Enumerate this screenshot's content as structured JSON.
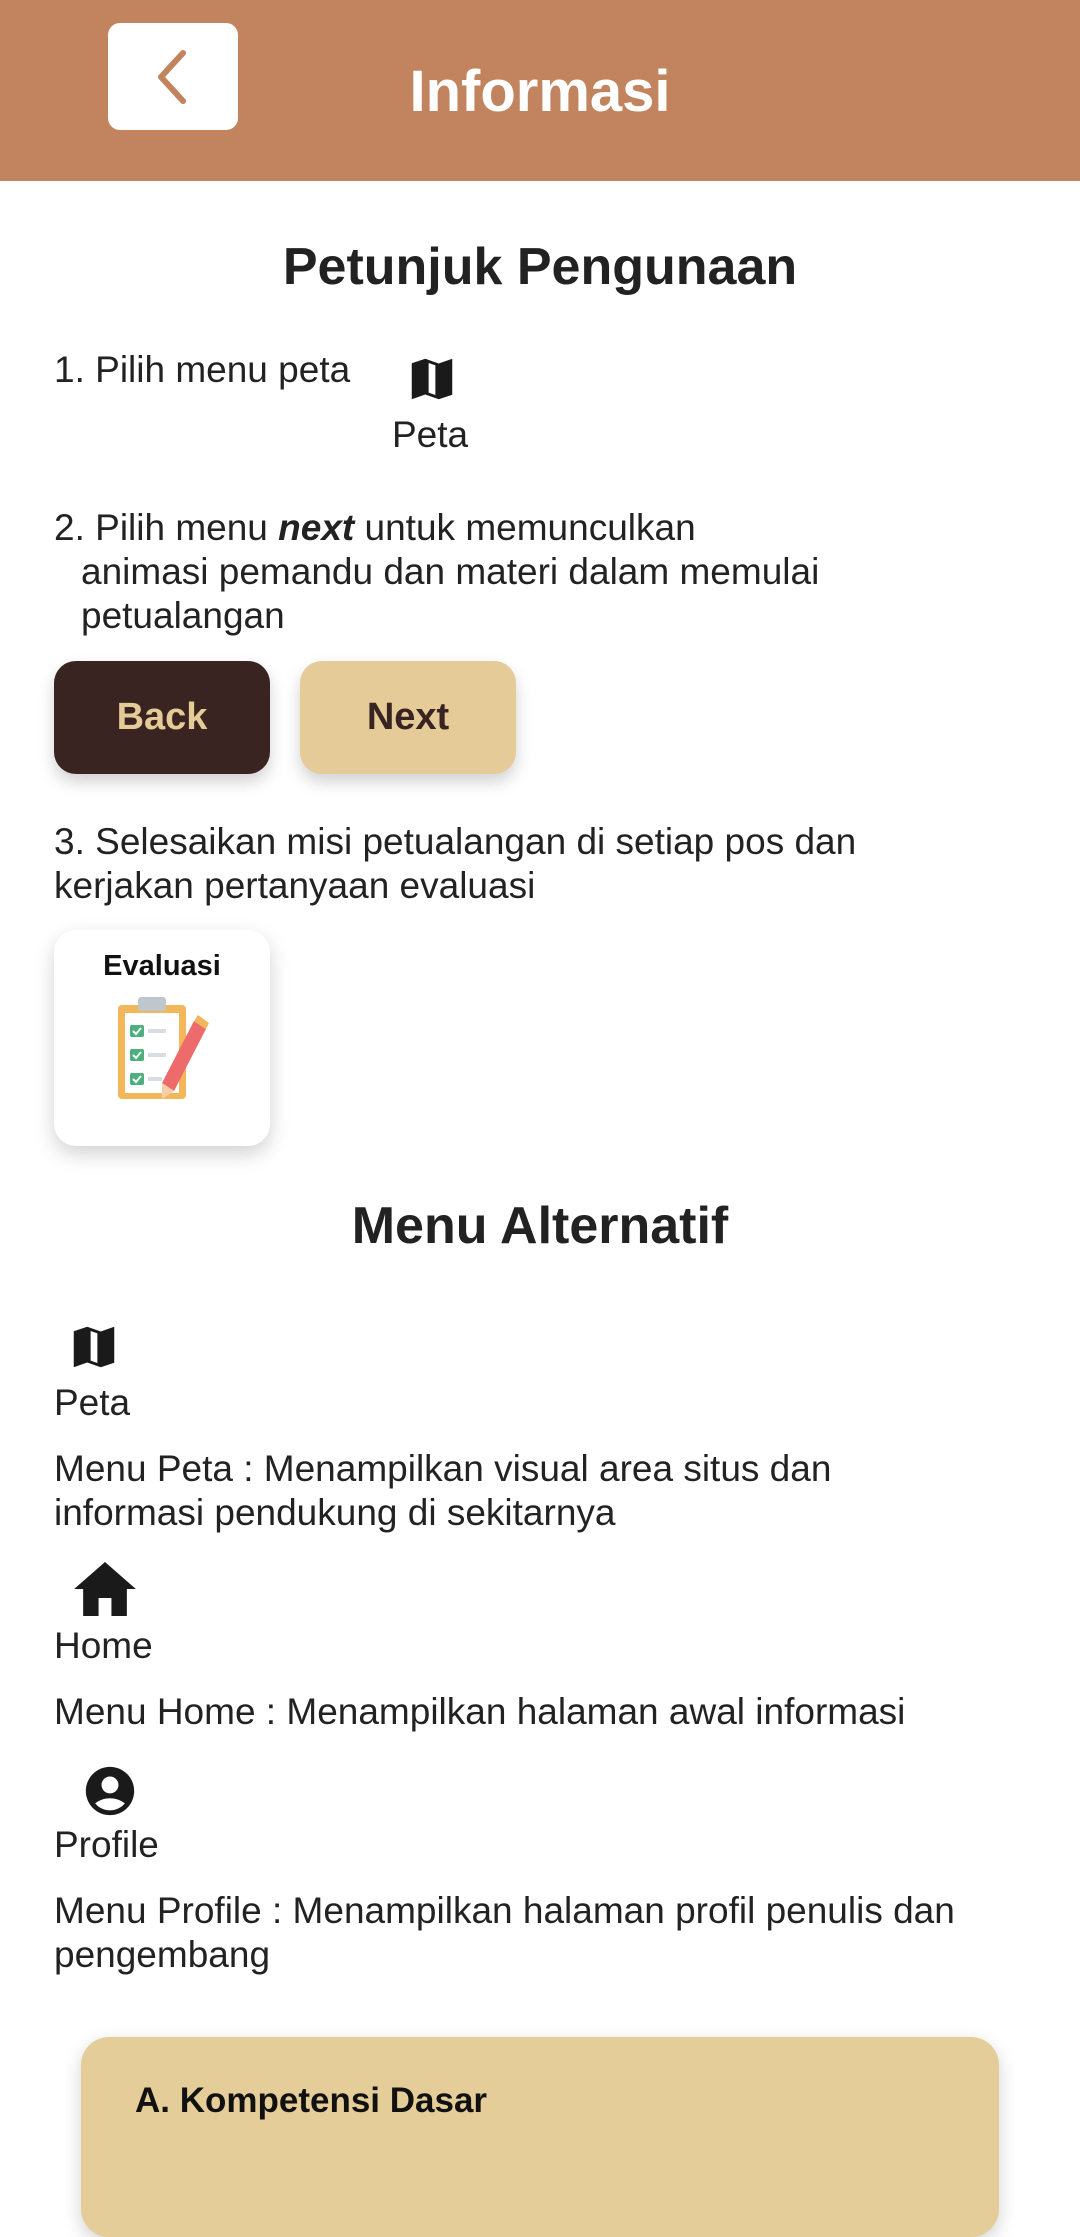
{
  "header": {
    "title": "Informasi",
    "back_icon": "chevron-left-icon",
    "color": "#C2845F"
  },
  "guide": {
    "title": "Petunjuk Pengunaan",
    "step1": {
      "text": "1. Pilih menu peta",
      "icon": "map-icon",
      "icon_label": "Peta"
    },
    "step2": {
      "prefix": "2. Pilih menu ",
      "emphasis": "next",
      "suffix": " untuk memunculkan",
      "line2": "animasi pemandu dan materi dalam memulai",
      "line3": "petualangan"
    },
    "buttons": {
      "back_label": "Back",
      "next_label": "Next"
    },
    "step3": {
      "line1": "3. Selesaikan misi petualangan di setiap pos dan",
      "line2": "kerjakan pertanyaan evaluasi"
    },
    "evaluasi_card": {
      "label": "Evaluasi",
      "icon": "clipboard-checklist-icon"
    }
  },
  "alt_menu": {
    "title": "Menu Alternatif",
    "items": [
      {
        "icon": "map-icon",
        "label": "Peta",
        "desc_line1": "Menu Peta : Menampilkan visual area situs dan",
        "desc_line2": "informasi pendukung di sekitarnya"
      },
      {
        "icon": "home-icon",
        "label": "Home",
        "desc_line1": "Menu Home : Menampilkan halaman awal informasi"
      },
      {
        "icon": "account-circle-icon",
        "label": "Profile",
        "desc_line1": "Menu Profile : Menampilkan halaman profil penulis dan",
        "desc_line2": "pengembang"
      }
    ]
  },
  "kompetensi": {
    "title": "A. Kompetensi Dasar"
  },
  "colors": {
    "dark_brown": "#3A2422",
    "beige": "#E4CB97"
  }
}
